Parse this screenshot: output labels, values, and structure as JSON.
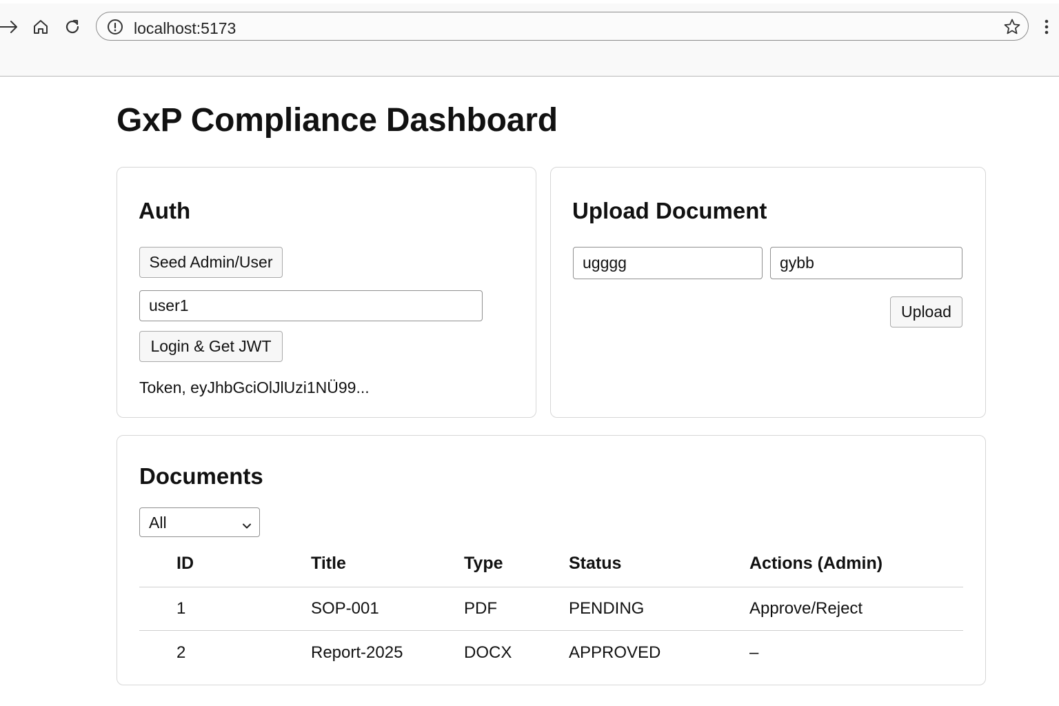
{
  "browser": {
    "url": "localhost:5173",
    "icons": [
      "forward-icon",
      "home-icon",
      "reload-icon",
      "info-icon",
      "star-icon",
      "menu-icon"
    ]
  },
  "page": {
    "title": "GxP Compliance Dashboard"
  },
  "auth": {
    "heading": "Auth",
    "seed_button": "Seed Admin/User",
    "username_value": "user1",
    "login_button": "Login & Get JWT",
    "token_text": "Token, eyJhbGciOlJlUzi1NÜ99..."
  },
  "upload": {
    "heading": "Upload Document",
    "title_value": "ugggg",
    "type_value": "gybb",
    "upload_button": "Upload"
  },
  "documents": {
    "heading": "Documents",
    "filter_selected": "All",
    "columns": [
      "ID",
      "Title",
      "Type",
      "Status",
      "Actions (Admin)"
    ],
    "rows": [
      {
        "id": "1",
        "title": "SOP-001",
        "type": "PDF",
        "status": "PENDING",
        "actions": "Approve/Reject"
      },
      {
        "id": "2",
        "title": "Report-2025",
        "type": "DOCX",
        "status": "APPROVED",
        "actions": "–"
      }
    ]
  }
}
